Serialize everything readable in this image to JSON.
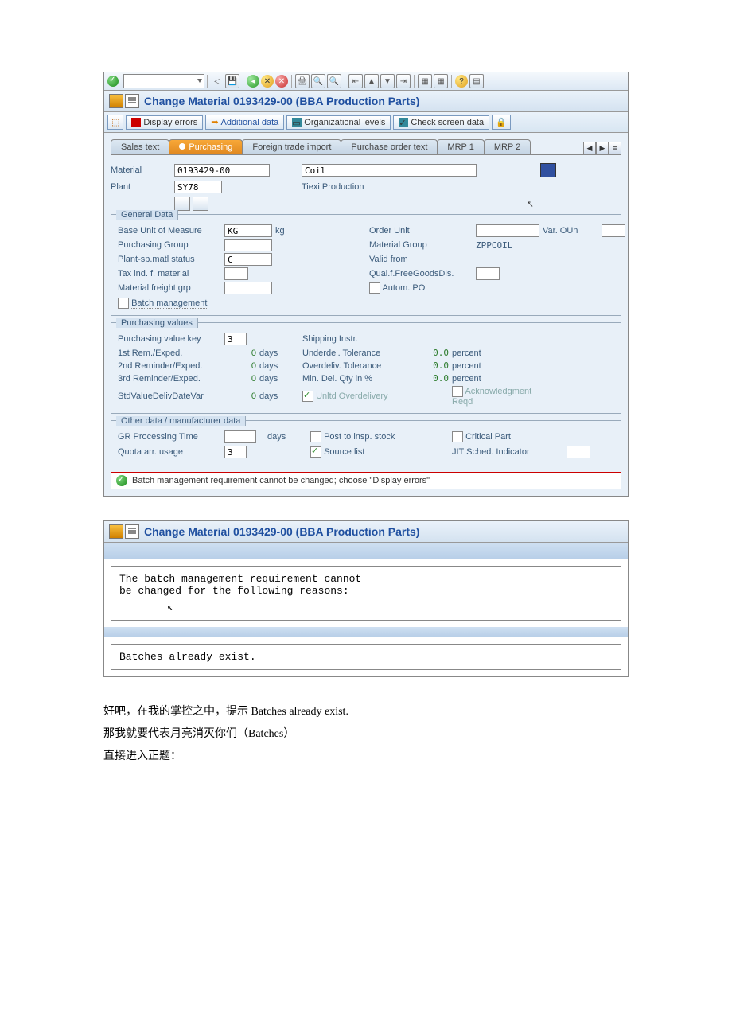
{
  "title": "Change Material 0193429-00 (BBA Production Parts)",
  "toolbar": {
    "display_errors": "Display errors",
    "additional_data": "Additional data",
    "org_levels": "Organizational levels",
    "check_screen": "Check screen data"
  },
  "tabs": {
    "sales_text": "Sales text",
    "purchasing": "Purchasing",
    "foreign": "Foreign trade import",
    "po_text": "Purchase order text",
    "mrp1": "MRP 1",
    "mrp2": "MRP 2"
  },
  "header": {
    "material_lbl": "Material",
    "material_val": "0193429-00",
    "material_desc": "Coil",
    "plant_lbl": "Plant",
    "plant_val": "SY78",
    "plant_desc": "Tiexi Production"
  },
  "general": {
    "title": "General Data",
    "base_uom_lbl": "Base Unit of Measure",
    "base_uom_val": "KG",
    "base_uom_txt": "kg",
    "order_unit_lbl": "Order Unit",
    "var_oun_lbl": "Var. OUn",
    "purch_grp_lbl": "Purchasing Group",
    "mat_grp_lbl": "Material Group",
    "mat_grp_val": "ZPPCOIL",
    "plant_status_lbl": "Plant-sp.matl status",
    "plant_status_val": "C",
    "valid_from_lbl": "Valid from",
    "tax_ind_lbl": "Tax ind. f. material",
    "qual_lbl": "Qual.f.FreeGoodsDis.",
    "freight_lbl": "Material freight grp",
    "autopo_lbl": "Autom. PO",
    "batch_lbl": "Batch management"
  },
  "purch": {
    "title": "Purchasing values",
    "key_lbl": "Purchasing value key",
    "key_val": "3",
    "ship_lbl": "Shipping Instr.",
    "rem1_lbl": "1st Rem./Exped.",
    "rem2_lbl": "2nd Reminder/Exped.",
    "rem3_lbl": "3rd Reminder/Exped.",
    "std_lbl": "StdValueDelivDateVar",
    "rem1_val": "0",
    "rem2_val": "0",
    "rem3_val": "0",
    "std_val": "0",
    "days": "days",
    "under_lbl": "Underdel. Tolerance",
    "over_lbl": "Overdeliv. Tolerance",
    "min_lbl": "Min. Del. Qty in %",
    "unltd_lbl": "Unltd Overdelivery",
    "under_val": "0.0",
    "over_val": "0.0",
    "min_val": "0.0",
    "percent": "percent",
    "ack_lbl": "Acknowledgment Reqd"
  },
  "other": {
    "title": "Other data / manufacturer data",
    "gr_lbl": "GR Processing Time",
    "days": "days",
    "post_lbl": "Post to insp. stock",
    "crit_lbl": "Critical Part",
    "quota_lbl": "Quota arr. usage",
    "quota_val": "3",
    "src_lbl": "Source list",
    "jit_lbl": "JIT Sched. Indicator"
  },
  "status_msg": "Batch management requirement cannot be changed; choose \"Display errors\"",
  "dialog": {
    "title": "Change Material 0193429-00 (BBA Production Parts)",
    "msg": "The batch management requirement cannot\nbe changed for the following reasons:",
    "reason": "Batches already exist."
  },
  "post": {
    "l1": "好吧，在我的掌控之中，提示 Batches already exist.",
    "l2": "那我就要代表月亮消灭你们（Batches）",
    "l3": "直接进入正题："
  }
}
